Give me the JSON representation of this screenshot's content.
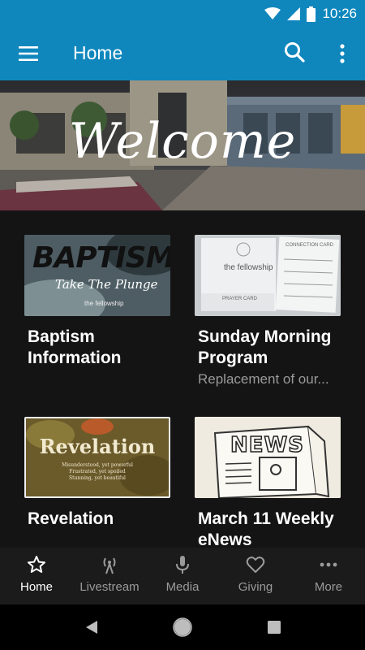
{
  "status_bar": {
    "time": "10:26",
    "icons": [
      "wifi-icon",
      "cell-signal-icon",
      "battery-icon"
    ]
  },
  "app_bar": {
    "title": "Home",
    "icons": [
      "menu-icon",
      "search-icon",
      "more-vert-icon"
    ]
  },
  "hero": {
    "text": "Welcome"
  },
  "cards": [
    {
      "title": "Baptism Information",
      "subtitle": "",
      "thumb_text": "BAPTISM",
      "thumb_script": "Take The Plunge",
      "thumb_footer": "the fellowship"
    },
    {
      "title": "Sunday Morning Program",
      "subtitle": "Replacement of our...",
      "thumb_text": "the fellowship",
      "thumb_label1": "PRAYER CARD",
      "thumb_label2": "CONNECTION CARD"
    },
    {
      "title": "Revelation",
      "subtitle": "",
      "thumb_text": "Revelation",
      "thumb_lines": [
        "Misunderstood, yet powerful",
        "Frustrated, yet spoiled",
        "Stunning, yet beautiful"
      ]
    },
    {
      "title": "March 11 Weekly eNews",
      "subtitle": "",
      "thumb_text": "NEWS"
    }
  ],
  "bottom_nav": [
    {
      "label": "Home",
      "icon": "star-icon",
      "active": true
    },
    {
      "label": "Livestream",
      "icon": "broadcast-icon",
      "active": false
    },
    {
      "label": "Media",
      "icon": "microphone-icon",
      "active": false
    },
    {
      "label": "Giving",
      "icon": "heart-icon",
      "active": false
    },
    {
      "label": "More",
      "icon": "more-horiz-icon",
      "active": false
    }
  ],
  "system_nav": [
    "back-icon",
    "home-circle-icon",
    "recents-icon"
  ],
  "colors": {
    "primary": "#0f87bd",
    "background": "#141414",
    "nav_background": "#1b1b1b",
    "inactive": "#9a9a9a"
  }
}
